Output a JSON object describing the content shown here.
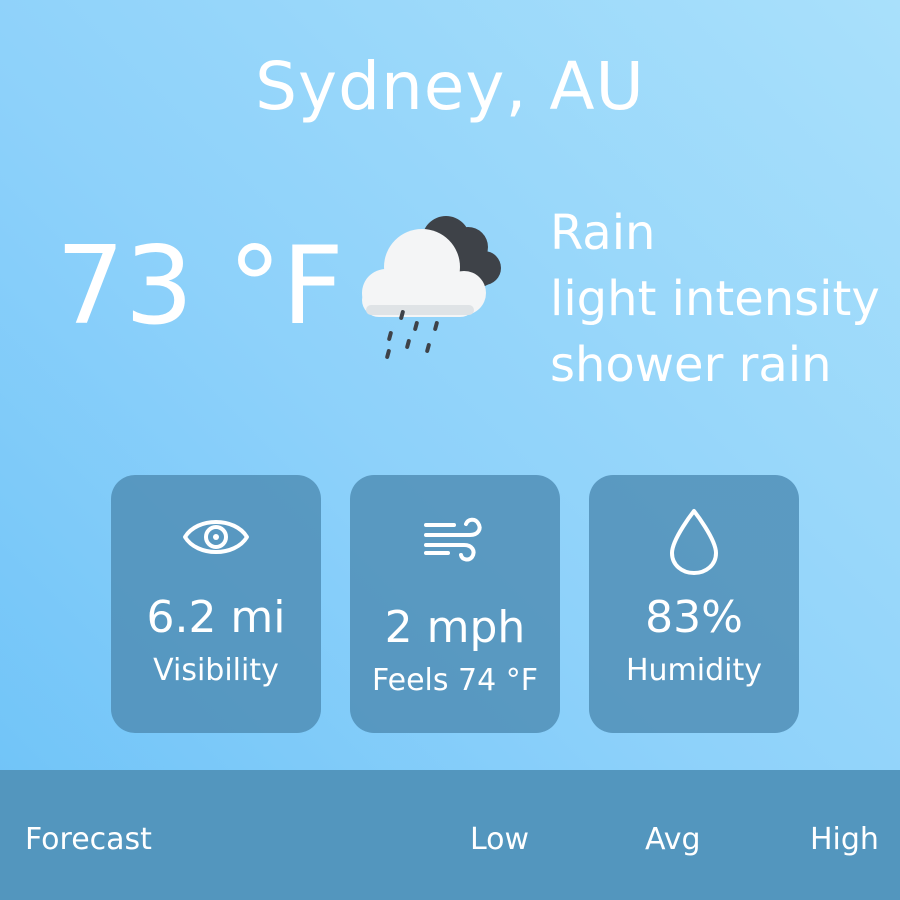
{
  "location": {
    "city": "Sydney, AU"
  },
  "current": {
    "temperature": "73 °F",
    "icon": "cloud-rain-icon",
    "condition_main": "Rain",
    "condition_line1": "light intensity",
    "condition_line2": "shower rain"
  },
  "stats": [
    {
      "icon": "eye-icon",
      "value": "6.2 mi",
      "label": "Visibility"
    },
    {
      "icon": "wind-icon",
      "value": "2 mph",
      "label": "Feels 74 °F"
    },
    {
      "icon": "droplet-icon",
      "value": "83%",
      "label": "Humidity"
    }
  ],
  "forecast_header": {
    "title": "Forecast",
    "low": "Low",
    "avg": "Avg",
    "high": "High"
  },
  "colors": {
    "background_start": "#6cc2f8",
    "background_end": "#a9e0fb",
    "card": "#4e8cb4",
    "footer": "#5396be",
    "text": "#ffffff"
  }
}
